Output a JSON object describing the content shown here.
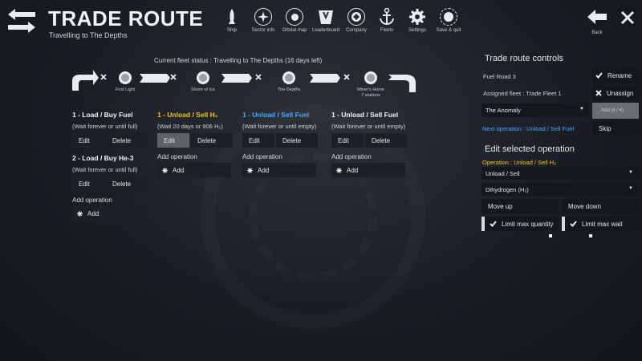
{
  "header": {
    "title": "TRADE ROUTE",
    "subtitle": "Travelling to The Depths",
    "nav": [
      {
        "label": "Ship",
        "icon": "ship-icon"
      },
      {
        "label": "Sector info",
        "icon": "sector-info-icon"
      },
      {
        "label": "Orbital map",
        "icon": "orbital-map-icon"
      },
      {
        "label": "Leaderboard",
        "icon": "leaderboard-icon"
      },
      {
        "label": "Company",
        "icon": "company-icon"
      },
      {
        "label": "Fleets",
        "icon": "anchor-icon"
      },
      {
        "label": "Settings",
        "icon": "gear-icon"
      },
      {
        "label": "Save & quit",
        "icon": "save-quit-icon"
      }
    ],
    "back_label": "Back"
  },
  "route": {
    "fleet_status": "Current fleet status : Travelling to The Depths (16 days left)",
    "stations": [
      {
        "name": "First Light",
        "detail": ""
      },
      {
        "name": "Shore of Ice",
        "detail": ""
      },
      {
        "name": "The Depths",
        "detail": ""
      },
      {
        "name": "Miner's Home",
        "detail": "7 stations"
      }
    ]
  },
  "columns": [
    {
      "operations": [
        {
          "title": "1 - Load / Buy Fuel",
          "color": "#f1f3f5",
          "condition": "(Wait forever or until full)",
          "edit": "Edit",
          "delete": "Delete"
        },
        {
          "title": "2 - Load / Buy He-3",
          "color": "#f1f3f5",
          "condition": "(Wait forever or until full)",
          "edit": "Edit",
          "delete": "Delete"
        }
      ],
      "add_label": "Add operation",
      "add_button": "Add"
    },
    {
      "operations": [
        {
          "title": "1 - Unload / Sell H₂",
          "color": "#f3c21a",
          "condition": "(Wait 20 days or 906 H₂)",
          "edit": "Edit",
          "delete": "Delete",
          "edit_active": true
        }
      ],
      "add_label": "Add operation",
      "add_button": "Add"
    },
    {
      "operations": [
        {
          "title": "1 - Unload / Sell Fuel",
          "color": "#4aa8ff",
          "condition": "(Wait forever or until empty)",
          "edit": "Edit",
          "delete": "Delete"
        }
      ],
      "add_label": "Add operation",
      "add_button": "Add"
    },
    {
      "operations": [
        {
          "title": "1 - Unload / Sell Fuel",
          "color": "#f1f3f5",
          "condition": "(Wait forever or until empty)",
          "edit": "Edit",
          "delete": "Delete"
        }
      ],
      "add_label": "Add operation",
      "add_button": "Add"
    }
  ],
  "controls": {
    "title": "Trade route controls",
    "route_name": "Fuel Road 3",
    "rename": "Rename",
    "assigned_fleet": "Assigned fleet : Trade Fleet 1",
    "unassign": "Unassign",
    "station_select": "The Anomaly",
    "add_count": "Add (4 / 4)",
    "next_operation": "Next operation : Unload / Sell Fuel",
    "skip": "Skip"
  },
  "edit": {
    "title": "Edit selected operation",
    "operation_label": "Operation : Unload / Sell H₂",
    "type_select": "Unload / Sell",
    "resource_select": "Dihydrogen (H₂)",
    "move_up": "Move up",
    "move_down": "Move down",
    "limit_quantity": "Limit max quantity",
    "limit_wait": "Limit max wait"
  },
  "colors": {
    "accent_yellow": "#f3c21a",
    "accent_blue": "#4aa8ff",
    "button_bg": "#1c2026",
    "background": "#1a1e24"
  }
}
